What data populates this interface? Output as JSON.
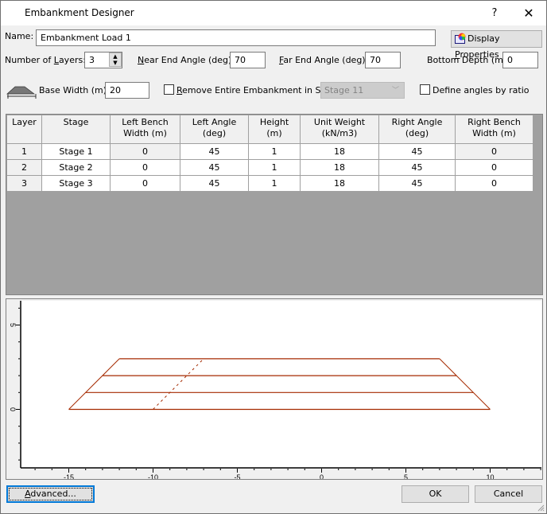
{
  "window": {
    "title": "Embankment Designer",
    "help_label": "?",
    "close_label": "✕"
  },
  "form": {
    "name_label": "Name:",
    "name_value": "Embankment Load 1",
    "display_properties_label": "Display Properties",
    "num_layers_label": "Number of Layers:",
    "num_layers_value": "3",
    "near_end_angle_label": "Near End Angle (deg):",
    "near_end_angle_value": "70",
    "far_end_angle_label": "Far End Angle (deg):",
    "far_end_angle_value": "70",
    "bottom_depth_label": "Bottom Depth (m):",
    "bottom_depth_value": "0",
    "base_width_label": "Base Width (m):",
    "base_width_value": "20",
    "remove_embankment_label": "Remove Entire Embankment in Stage",
    "remove_embankment_checked": false,
    "remove_stage_value": "Stage 11",
    "define_angles_label": "Define angles by ratio",
    "define_angles_checked": false
  },
  "table": {
    "headers": [
      [
        "Layer",
        ""
      ],
      [
        "Stage",
        ""
      ],
      [
        "Left Bench",
        "Width (m)"
      ],
      [
        "Left Angle",
        "(deg)"
      ],
      [
        "Height",
        "(m)"
      ],
      [
        "Unit Weight",
        "(kN/m3)"
      ],
      [
        "Right Angle",
        "(deg)"
      ],
      [
        "Right Bench",
        "Width (m)"
      ]
    ],
    "rows": [
      [
        "1",
        "Stage 1",
        "0",
        "45",
        "1",
        "18",
        "45",
        "0"
      ],
      [
        "2",
        "Stage 2",
        "0",
        "45",
        "1",
        "18",
        "45",
        "0"
      ],
      [
        "3",
        "Stage 3",
        "0",
        "45",
        "1",
        "18",
        "45",
        "0"
      ]
    ]
  },
  "chart_data": {
    "type": "line",
    "title": "",
    "xlabel": "",
    "ylabel": "",
    "xlim": [
      -17.5,
      13
    ],
    "ylim": [
      -4,
      6.5
    ],
    "x_ticks": [
      -15,
      -10,
      -5,
      0,
      5,
      10
    ],
    "y_ticks": [
      0,
      5
    ],
    "line_color": "#a52a00",
    "layer_lines": [
      {
        "name": "layer-0",
        "y": 0,
        "x": [
          -15,
          10
        ]
      },
      {
        "name": "layer-1",
        "y": 1,
        "x": [
          -14,
          9
        ]
      },
      {
        "name": "layer-2",
        "y": 2,
        "x": [
          -13,
          8
        ]
      },
      {
        "name": "layer-3",
        "y": 3,
        "x": [
          -12,
          7
        ]
      }
    ],
    "left_slope": [
      [
        -15,
        0
      ],
      [
        -12,
        3
      ]
    ],
    "right_slope": [
      [
        10,
        0
      ],
      [
        7,
        3
      ]
    ],
    "dashed_line": [
      [
        -10,
        0
      ],
      [
        -7,
        3
      ]
    ]
  },
  "footer": {
    "advanced_label": "Advanced...",
    "ok_label": "OK",
    "cancel_label": "Cancel"
  }
}
